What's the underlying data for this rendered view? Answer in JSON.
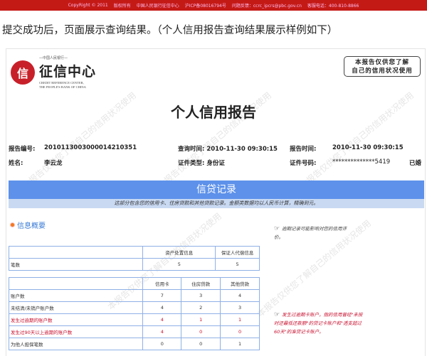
{
  "footer_bar": {
    "items": [
      "CopyRight © 2011",
      "版权所有",
      "中国人民银行征信中心",
      "沪ICP备08016794号",
      "问题反馈：ccrc_ipcrs@pbc.gov.cn",
      "客服电话：400-810-8866"
    ]
  },
  "intro": "提交成功后，页面展示查询结果。（个人信用报告查询结果展示样例如下）",
  "logo": {
    "top": "—中国人民银行—",
    "name": "征信中心",
    "en1": "CREDIT REFERENCE CENTER,",
    "en2": "THE PEOPLE'S BANK OF CHINA"
  },
  "stamp": {
    "line1": "本报告仅供您了解",
    "line2": "自己的信用状况使用"
  },
  "watermark": "本报告仅供您了解自己的信用状况使用",
  "title": "个人信用报告",
  "info": {
    "report_no_label": "报告编号:",
    "report_no": "2010113003000014210351",
    "query_time": "查询时间: 2010-11-30 09:30:15",
    "report_time_label": "报告时间:",
    "report_time": "2010-11-30 09:30:15",
    "name_label": "姓名:",
    "name": "李云龙",
    "id_type": "证件类型: 身份证",
    "id_no_label": "证件号码:",
    "id_no": "**************5419",
    "marital": "已婚"
  },
  "section": {
    "title": "信贷记录",
    "subtitle": "这部分包含您的信用卡、住房贷款和其他贷款记录。金额类数据均以人民币计算，精确到元。"
  },
  "summary": {
    "title": "信息概要",
    "table1": {
      "headers": [
        "",
        "资产处置信息",
        "保证人代偿信息"
      ],
      "rows": [
        [
          "笔数",
          "5",
          "5"
        ]
      ]
    },
    "table2": {
      "headers": [
        "",
        "信用卡",
        "住房贷款",
        "其他贷款"
      ],
      "rows": [
        {
          "cells": [
            "账户数",
            "7",
            "3",
            "4"
          ],
          "red": false
        },
        {
          "cells": [
            "未结清/未销户账户数",
            "4",
            "2",
            "3"
          ],
          "red": false
        },
        {
          "cells": [
            "发生过逾期的账户数",
            "4",
            "1",
            "1"
          ],
          "red": true
        },
        {
          "cells": [
            "发生过90天以上逾期的账户数",
            "4",
            "0",
            "0"
          ],
          "red": true
        },
        {
          "cells": [
            "为他人担保笔数",
            "0",
            "0",
            "1"
          ],
          "red": false
        }
      ]
    },
    "note1": "逾期记录可能影响对您的信用评价。",
    "note2": "发生过逾期卡账户，指的信用曾经\"未按时还最低还款额\"的贷记卡账户和\"透支超过60天\"的准贷记卡账户。"
  },
  "colors": {
    "topbar": "#c41a16",
    "band": "#5d91ea",
    "subband": "#c9d9f2",
    "red_text": "#c8102e",
    "link": "#3a7bd5"
  }
}
